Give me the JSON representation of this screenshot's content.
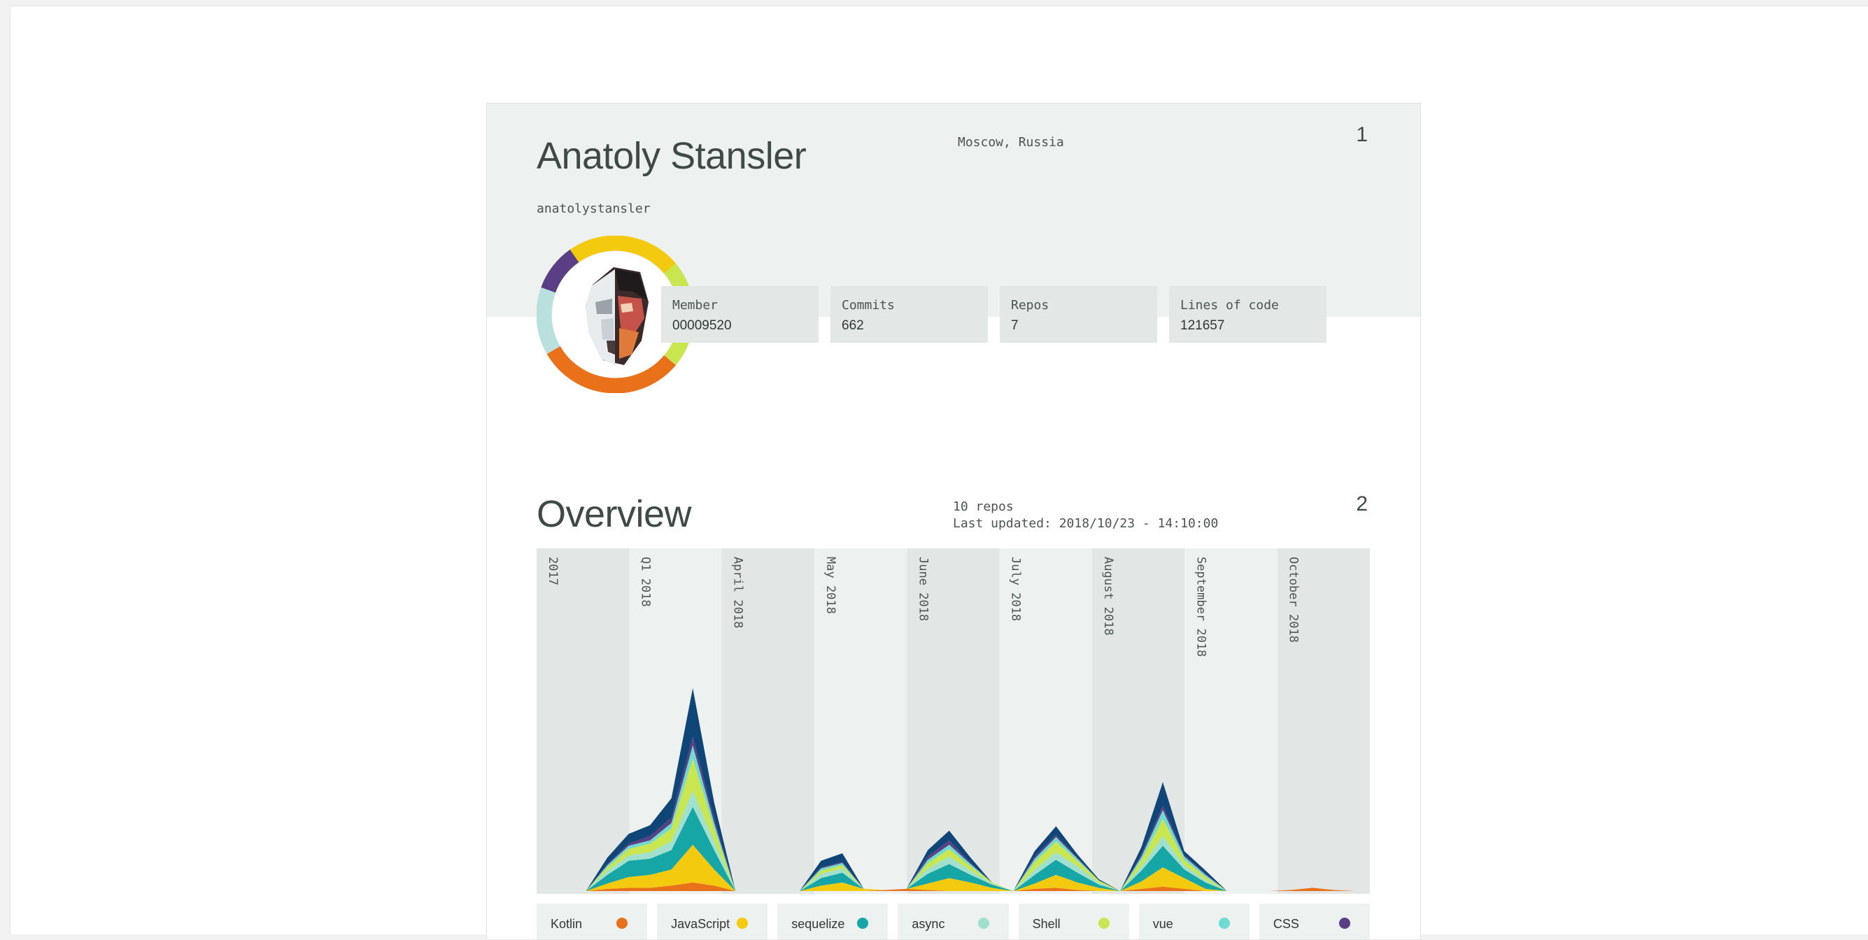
{
  "profile": {
    "name": "Anatoly Stansler",
    "username": "anatolystansler",
    "location": "Moscow, Russia",
    "page_number": "1",
    "stats": [
      {
        "label": "Member",
        "value": "00009520"
      },
      {
        "label": "Commits",
        "value": "662"
      },
      {
        "label": "Repos",
        "value": "7"
      },
      {
        "label": "Lines of code",
        "value": "121657"
      }
    ],
    "avatar_ring_colors": [
      "#f4ca0e",
      "#c9e651",
      "#e8711a",
      "#b9e0dd",
      "#5b3f86"
    ]
  },
  "overview": {
    "title": "Overview",
    "repos": "10 repos",
    "updated": "Last updated: 2018/10/23 - 14:10:00",
    "page_number": "2"
  },
  "chart_data": {
    "type": "area",
    "stacked": true,
    "periods": [
      "2017",
      "Q1 2018",
      "April 2018",
      "May 2018",
      "June 2018",
      "July 2018",
      "August 2018",
      "September 2018",
      "October 2018"
    ],
    "y_scale": "relative, unlabeled",
    "series": [
      {
        "name": "Kotlin",
        "color": "#e8711a",
        "values": [
          0,
          0,
          0.2,
          0.3,
          0.3,
          0.5,
          0.8,
          0.5,
          0,
          0,
          0,
          0,
          0,
          0,
          0,
          0.1,
          0.2,
          0.1,
          0,
          0,
          0,
          0,
          0.2,
          0.3,
          0.1,
          0,
          0,
          0.2,
          0.4,
          0.2,
          0,
          0,
          0,
          0,
          0.1,
          0.3,
          0.1,
          0
        ]
      },
      {
        "name": "JavaScript",
        "color": "#f4ca0e",
        "values": [
          0,
          0,
          0.5,
          1.0,
          1.2,
          1.5,
          3.5,
          1.5,
          0,
          0,
          0,
          0,
          0.5,
          0.8,
          0.2,
          0,
          0,
          0.6,
          1.2,
          0.8,
          0.3,
          0,
          0.5,
          1.2,
          0.7,
          0.3,
          0,
          0.7,
          1.8,
          1.0,
          0.2,
          0
        ]
      },
      {
        "name": "sequelize",
        "color": "#16a6a6",
        "values": [
          0,
          0,
          0.8,
          1.5,
          1.5,
          1.8,
          3.5,
          1.8,
          0,
          0,
          0,
          0,
          0.7,
          0.9,
          0,
          0,
          0,
          0.9,
          1.3,
          0.7,
          0.3,
          0,
          0.8,
          1.4,
          0.9,
          0.3,
          0,
          1.0,
          2.0,
          0.8,
          0.6,
          0
        ]
      },
      {
        "name": "async",
        "color": "#a0e0cc",
        "values": [
          0,
          0,
          0.4,
          0.5,
          0.6,
          0.8,
          1.5,
          0.8,
          0,
          0,
          0,
          0,
          0.4,
          0.4,
          0,
          0,
          0,
          0.5,
          0.7,
          0.4,
          0.1,
          0,
          0.5,
          0.7,
          0.6,
          0.2,
          0,
          0.4,
          0.9,
          0.4,
          0.2,
          0
        ]
      },
      {
        "name": "Shell",
        "color": "#c9e651",
        "values": [
          0,
          0,
          0.3,
          0.6,
          0.8,
          1.2,
          3.0,
          1.2,
          0,
          0,
          0,
          0,
          0.3,
          0.3,
          0,
          0,
          0,
          0.5,
          0.7,
          0.4,
          0.1,
          0,
          0.7,
          1.0,
          0.5,
          0.2,
          0,
          0.6,
          1.6,
          0.5,
          0.3,
          0
        ]
      },
      {
        "name": "vue",
        "color": "#6fd9d2",
        "values": [
          0,
          0,
          0.2,
          0.3,
          0.3,
          0.5,
          1.2,
          0.5,
          0,
          0,
          0,
          0,
          0.2,
          0.2,
          0,
          0,
          0,
          0.3,
          0.4,
          0.2,
          0,
          0,
          0.3,
          0.4,
          0.2,
          0,
          0,
          0.3,
          0.8,
          0.3,
          0.2,
          0
        ]
      },
      {
        "name": "CSS",
        "color": "#5b3f86",
        "values": [
          0,
          0,
          0.1,
          0.2,
          0.4,
          0.5,
          0.8,
          0.4,
          0,
          0,
          0,
          0,
          0.1,
          0.1,
          0,
          0,
          0,
          0.3,
          0.4,
          0.1,
          0,
          0,
          0.2,
          0.2,
          0.1,
          0,
          0,
          0.2,
          0.4,
          0.1,
          0.1,
          0
        ]
      },
      {
        "name": "",
        "color": "#0f4677",
        "values": [
          0,
          0,
          0.6,
          0.9,
          1.0,
          1.8,
          4.5,
          1.5,
          0,
          0,
          0,
          0,
          0.6,
          0.8,
          0,
          0,
          0,
          0.6,
          0.9,
          0.5,
          0,
          0,
          0.5,
          0.8,
          0.3,
          0.1,
          0,
          0.7,
          2.2,
          0.4,
          0.3,
          0
        ]
      }
    ]
  }
}
